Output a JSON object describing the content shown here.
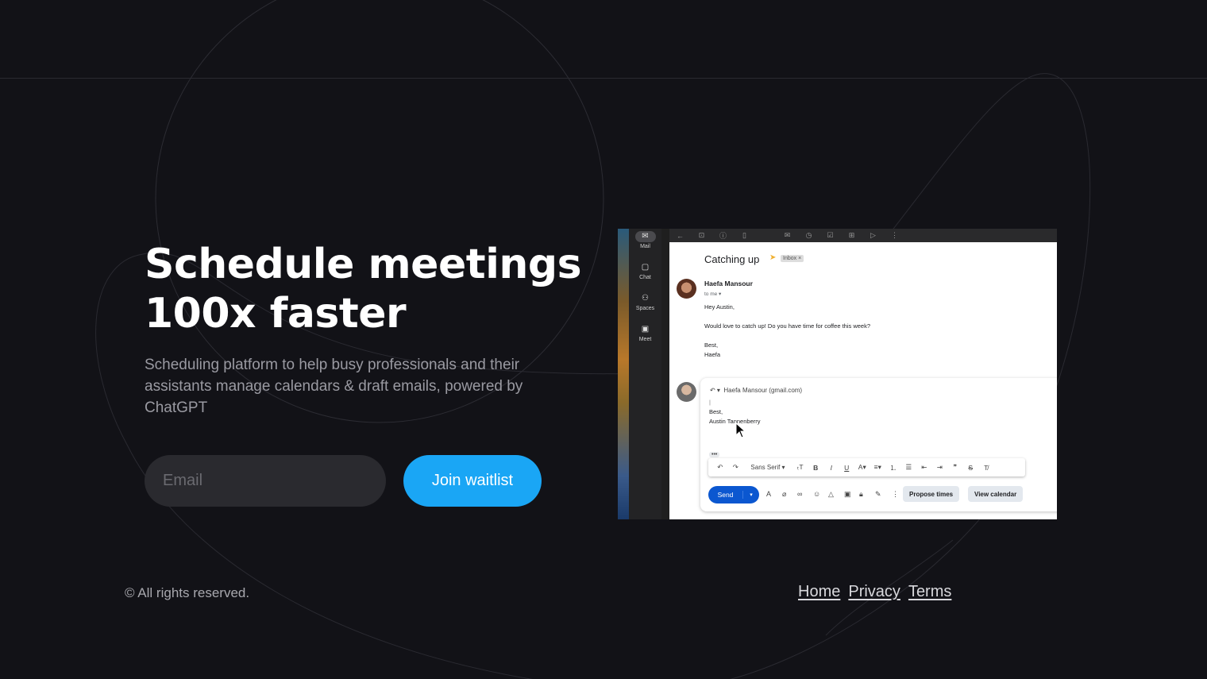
{
  "hero": {
    "title_line1": "Schedule meetings",
    "title_line2": "100x faster",
    "subtitle": "Scheduling platform to help busy professionals and their assistants manage calendars & draft emails, powered by ChatGPT"
  },
  "signup": {
    "email_placeholder": "Email",
    "email_value": "",
    "button_label": "Join waitlist"
  },
  "footer": {
    "copyright": "© All rights reserved.",
    "links": [
      {
        "label": "Home"
      },
      {
        "label": "Privacy"
      },
      {
        "label": "Terms"
      }
    ]
  },
  "colors": {
    "background": "#121217",
    "accent": "#1aa6f5",
    "input_bg": "#2a2a2f"
  },
  "preview": {
    "rail": [
      {
        "label": "Mail",
        "icon": "mail-icon"
      },
      {
        "label": "Chat",
        "icon": "chat-icon"
      },
      {
        "label": "Spaces",
        "icon": "spaces-icon"
      },
      {
        "label": "Meet",
        "icon": "meet-icon"
      }
    ],
    "subject": "Catching up",
    "label_badge": "Inbox ×",
    "sender": "Haefa Mansour",
    "to_line": "to me ▾",
    "body": [
      "Hey Austin,",
      "Would love to catch up! Do you have time for coffee this week?",
      "Best,",
      "Haefa"
    ],
    "reply_to": "Haefa Mansour (gmail.com)",
    "reply_body": [
      "Best,",
      "Austin Tannenberry"
    ],
    "font_select": "Sans Serif",
    "send_label": "Send",
    "propose_label": "Propose times",
    "calendar_label": "View calendar"
  }
}
